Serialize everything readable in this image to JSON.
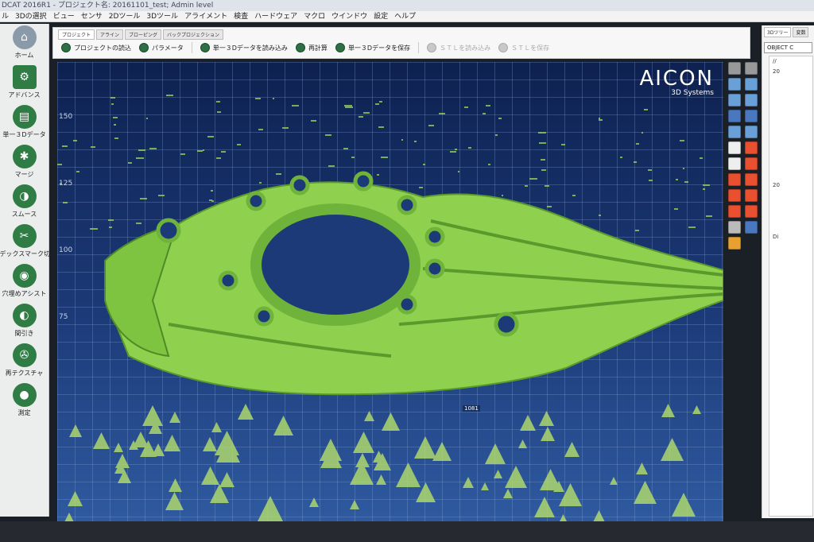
{
  "window": {
    "title": "DCAT 2016R1 - プロジェクト名: 20161101_test; Admin level"
  },
  "menu": [
    "ル",
    "3Dの選択",
    "ビュー",
    "センサ",
    "2Dツール",
    "3Dツール",
    "アライメント",
    "検査",
    "ハードウェア",
    "マクロ",
    "ウインドウ",
    "設定",
    "ヘルプ"
  ],
  "sidebar": {
    "items": [
      {
        "label": "ホーム",
        "icon": "home-icon",
        "color": "#8a9aa8"
      },
      {
        "label": "アドバンス",
        "icon": "advanced-icon",
        "color": "#2f7d45"
      },
      {
        "label": "単一３Dデータ",
        "icon": "single-3d-data-icon",
        "color": "#2f7d45"
      },
      {
        "label": "マージ",
        "icon": "merge-icon",
        "color": "#2f7d45"
      },
      {
        "label": "スムース",
        "icon": "smooth-icon",
        "color": "#2f7d45"
      },
      {
        "label": "デックスマーク切",
        "icon": "cut-icon",
        "color": "#2f7d45"
      },
      {
        "label": "穴埋めアシスト",
        "icon": "hole-fill-icon",
        "color": "#2f7d45"
      },
      {
        "label": "間引き",
        "icon": "thinning-icon",
        "color": "#2f7d45"
      },
      {
        "label": "再テクスチャ",
        "icon": "retexture-icon",
        "color": "#2f7d45"
      },
      {
        "label": "測定",
        "icon": "measure-icon",
        "color": "#2f7d45"
      }
    ]
  },
  "ribbon": {
    "tabs": [
      "プロジェクト",
      "アライン",
      "ブローピング",
      "バックプロジェクション"
    ],
    "buttons": [
      {
        "label": "プロジェクトの読込",
        "enabled": true
      },
      {
        "label": "パラメータ",
        "enabled": true
      },
      {
        "label": "単一３Dデータを読み込み",
        "enabled": true
      },
      {
        "label": "再計算",
        "enabled": true
      },
      {
        "label": "単一３Dデータを保存",
        "enabled": true
      },
      {
        "label": "ＳＴＬを読み込み",
        "enabled": false
      },
      {
        "label": "ＳＴＬを保存",
        "enabled": false
      }
    ]
  },
  "viewport": {
    "brand": "AICON",
    "brand_sub": "3D Systems",
    "ticks": [
      "150",
      "125",
      "100",
      "75"
    ],
    "coord_label": "1081",
    "colors": {
      "part": "#8fd14f",
      "part_dark": "#5a9a2c",
      "bg_top": "#0e2150",
      "bg_bottom": "#2f5aa0"
    }
  },
  "right_tools": [
    {
      "icon": "undo-icon",
      "color": "#999"
    },
    {
      "icon": "settings-icon",
      "color": "#999"
    },
    {
      "icon": "cube-front-icon",
      "color": "#6aa0d8"
    },
    {
      "icon": "cube-side-icon",
      "color": "#6aa0d8"
    },
    {
      "icon": "cube-top-icon",
      "color": "#6aa0d8"
    },
    {
      "icon": "cube-iso-icon",
      "color": "#6aa0d8"
    },
    {
      "icon": "pan-icon",
      "color": "#4a78c0"
    },
    {
      "icon": "zoom-icon",
      "color": "#4a78c0"
    },
    {
      "icon": "shade-icon",
      "color": "#6aa0d8"
    },
    {
      "icon": "wire-icon",
      "color": "#6aa0d8"
    },
    {
      "icon": "select-box-icon",
      "color": "#eee"
    },
    {
      "icon": "select-fill-icon",
      "color": "#e85030"
    },
    {
      "icon": "select-empty-icon",
      "color": "#eee"
    },
    {
      "icon": "select-tri-icon",
      "color": "#e85030"
    },
    {
      "icon": "add-icon",
      "color": "#e85030"
    },
    {
      "icon": "remove-icon",
      "color": "#e85030"
    },
    {
      "icon": "expand-red-icon",
      "color": "#e85030"
    },
    {
      "icon": "collapse-red-icon",
      "color": "#e85030"
    },
    {
      "icon": "ellipse-icon",
      "color": "#e85030"
    },
    {
      "icon": "diamond-icon",
      "color": "#e85030"
    },
    {
      "icon": "light-icon",
      "color": "#bbb"
    },
    {
      "icon": "grid-icon",
      "color": "#4a78c0"
    },
    {
      "icon": "axes-icon",
      "color": "#e8a030"
    }
  ],
  "right_panel": {
    "tabs": [
      "3Dツリー",
      "変数"
    ],
    "search_value": "OBJECT C",
    "tree": [
      "//",
      "20",
      "",
      "",
      "",
      "",
      "",
      "",
      "",
      "",
      "",
      "",
      "20",
      "",
      "",
      "",
      "",
      "Di"
    ]
  }
}
